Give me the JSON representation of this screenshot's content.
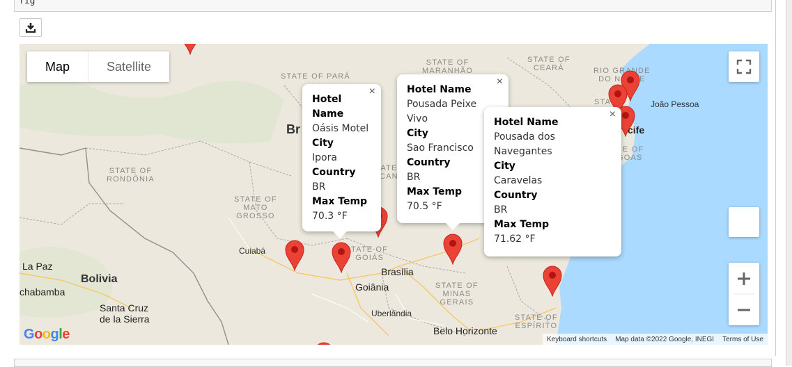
{
  "top_cell_text": "fig",
  "map_type": {
    "map": "Map",
    "satellite": "Satellite"
  },
  "states": {
    "para": "STATE OF PARÁ",
    "maranhao_1": "STATE OF",
    "maranhao_2": "MARANHÃO",
    "ceara_1": "STATE OF",
    "ceara_2": "CEARÁ",
    "rgn_1": "RIO GRANDE",
    "rgn_2": "DO NORTE",
    "paraiba": "STATE",
    "alagoas_1": "TE OF",
    "alagoas_2": "GOAS",
    "rondonia_1": "STATE OF",
    "rondonia_2": "RONDÔNIA",
    "mato_1": "STATE OF",
    "mato_2": "MATO",
    "mato_3": "GROSSO",
    "goias_1": "TATE OF",
    "goias_2": "GOIÁS",
    "minas_1": "STATE OF",
    "minas_2": "MINAS",
    "minas_3": "GERAIS",
    "espirito_1": "STATE OF",
    "espirito_2": "ESPÍRITO",
    "tocantins_1": "ATE",
    "tocantins_2": "CAN"
  },
  "cities": {
    "joao_pessoa": "João Pessoa",
    "recife": "cife",
    "cuiaba": "Cuiabá",
    "la_paz": "La Paz",
    "brasilia": "Brasília",
    "goiania": "Goiânia",
    "uberlandia": "Uberlândia",
    "cochabamba": "chabamba",
    "santa_cruz_1": "Santa Cruz",
    "santa_cruz_2": "de la Sierra",
    "belo_horizonte": "Belo Horizonte"
  },
  "countries": {
    "brazil": "Br",
    "bolivia": "Bolivia"
  },
  "info_windows": [
    {
      "hotel_label": "Hotel Name",
      "hotel": "Oásis Motel",
      "city_label": "City",
      "city": "Ipora",
      "country_label": "Country",
      "country": "BR",
      "temp_label": "Max Temp",
      "temp": "70.3 °F"
    },
    {
      "hotel_label": "Hotel Name",
      "hotel": "Pousada Peixe Vivo",
      "city_label": "City",
      "city": "Sao Francisco",
      "country_label": "Country",
      "country": "BR",
      "temp_label": "Max Temp",
      "temp": "70.5 °F"
    },
    {
      "hotel_label": "Hotel Name",
      "hotel": "Pousada dos Navegantes",
      "city_label": "City",
      "city": "Caravelas",
      "country_label": "Country",
      "country": "BR",
      "temp_label": "Max Temp",
      "temp": "71.62 °F"
    }
  ],
  "close_glyph": "×",
  "footer": {
    "shortcuts": "Keyboard shortcuts",
    "map_data": "Map data ©2022 Google, INEGI",
    "terms": "Terms of Use"
  },
  "logo_text": "Google",
  "colors": {
    "water": "#aadaff",
    "land": "#ece8dd",
    "pin": "#ea4335",
    "pin_dark": "#b31412"
  }
}
